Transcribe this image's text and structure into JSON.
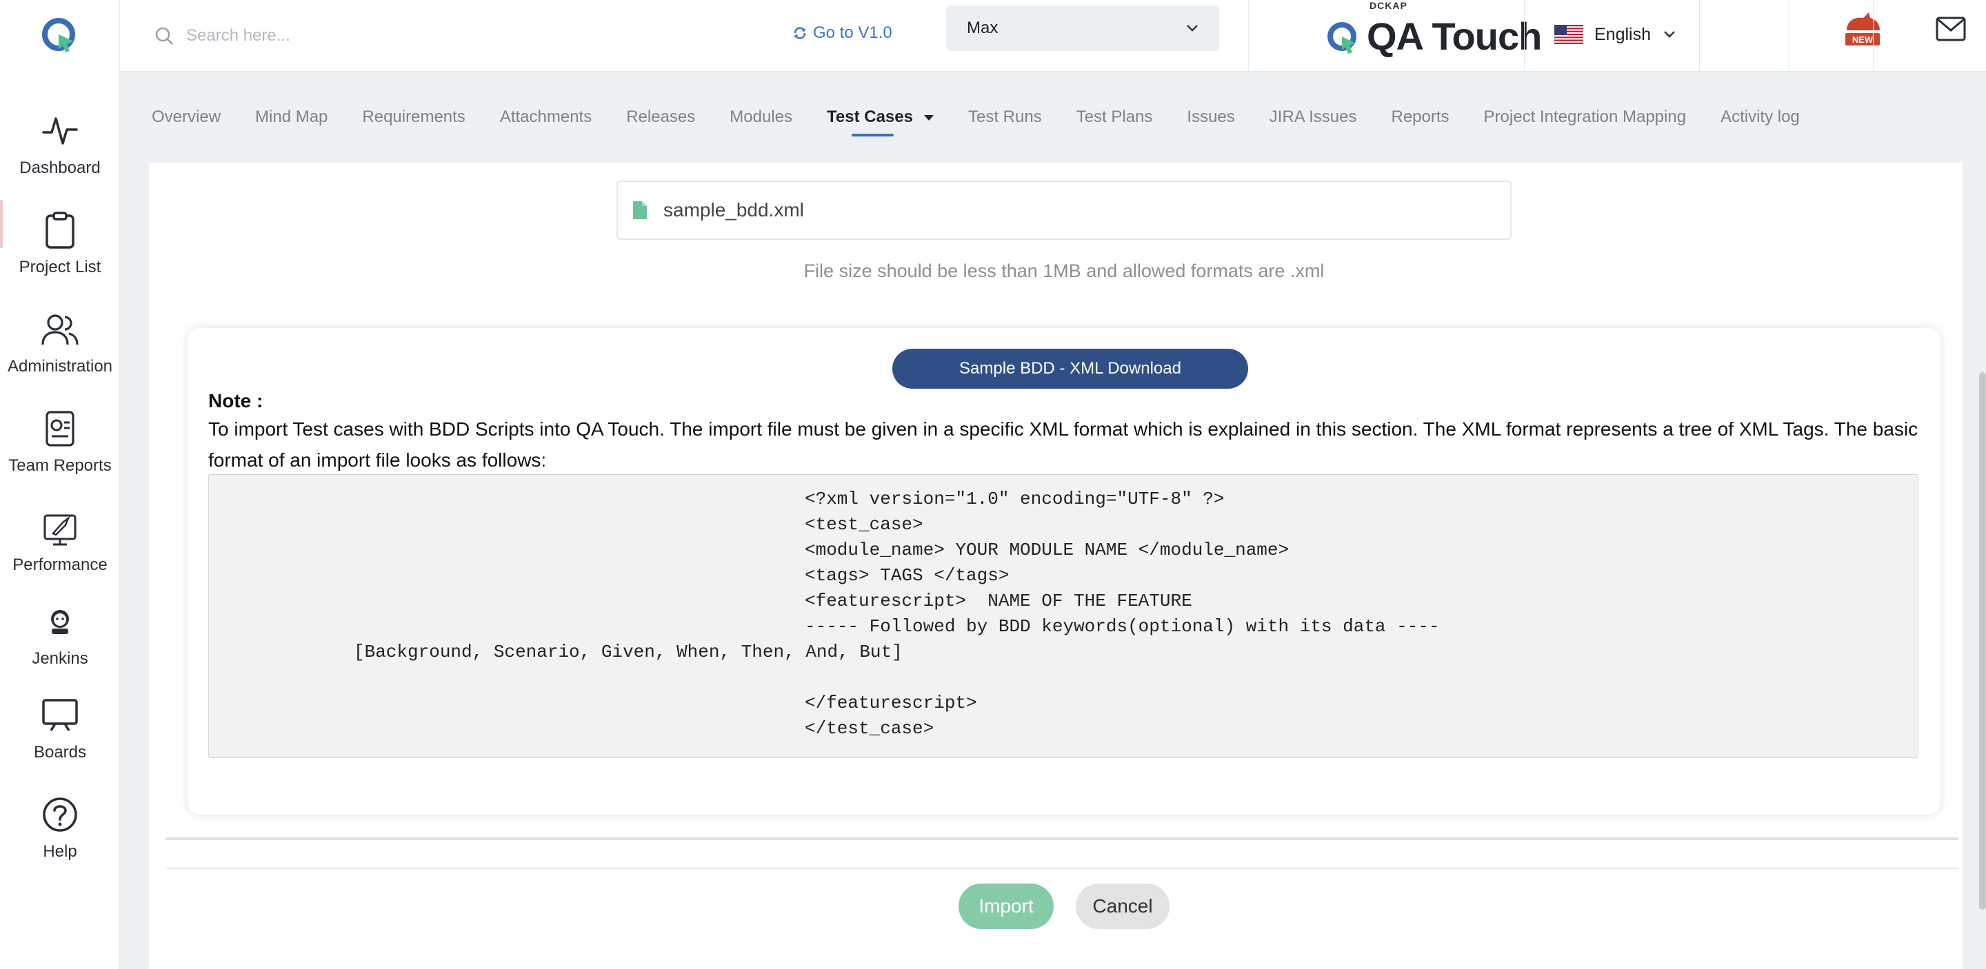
{
  "sidebar": {
    "logo": "qa-touch-logo",
    "items": [
      {
        "label": "Dashboard",
        "icon": "activity-icon"
      },
      {
        "label": "Project List",
        "icon": "clipboard-icon"
      },
      {
        "label": "Administration",
        "icon": "users-icon"
      },
      {
        "label": "Team Reports",
        "icon": "report-icon"
      },
      {
        "label": "Performance",
        "icon": "rocket-icon"
      },
      {
        "label": "Jenkins",
        "icon": "jenkins-icon"
      },
      {
        "label": "Boards",
        "icon": "board-icon"
      },
      {
        "label": "Help",
        "icon": "help-icon"
      }
    ]
  },
  "header": {
    "search_placeholder": "Search here...",
    "goto_label": "Go to V1.0",
    "project_selected": "Max",
    "brand_top": "DCKAP",
    "brand_name": "QA Touch",
    "language": "English",
    "new_badge": "NEW"
  },
  "tabs": [
    {
      "label": "Overview",
      "active": false
    },
    {
      "label": "Mind Map",
      "active": false
    },
    {
      "label": "Requirements",
      "active": false
    },
    {
      "label": "Attachments",
      "active": false
    },
    {
      "label": "Releases",
      "active": false
    },
    {
      "label": "Modules",
      "active": false
    },
    {
      "label": "Test Cases",
      "active": true
    },
    {
      "label": "Test Runs",
      "active": false
    },
    {
      "label": "Test Plans",
      "active": false
    },
    {
      "label": "Issues",
      "active": false
    },
    {
      "label": "JIRA Issues",
      "active": false
    },
    {
      "label": "Reports",
      "active": false
    },
    {
      "label": "Project Integration Mapping",
      "active": false
    },
    {
      "label": "Activity log",
      "active": false
    }
  ],
  "upload": {
    "file_name": "sample_bdd.xml",
    "hint": "File size should be less than 1MB and allowed formats are .xml"
  },
  "note": {
    "download_button": "Sample BDD - XML Download",
    "title": "Note :",
    "text": "To import Test cases with BDD Scripts into QA Touch. The import file must be given in a specific XML format which is explained in this section. The XML format represents a tree of XML Tags. The basic format of an import file looks as follows:",
    "code": [
      "<?xml version=\"1.0\" encoding=\"UTF-8\" ?>",
      "<test_case>",
      "<module_name> YOUR MODULE NAME </module_name>",
      "<tags> TAGS </tags>",
      "<featurescript>  NAME OF THE FEATURE",
      "----- Followed by BDD keywords(optional) with its data ----",
      "[Background, Scenario, Given, When, Then, And, But]",
      "</featurescript>",
      "</test_case>"
    ]
  },
  "actions": {
    "import": "Import",
    "cancel": "Cancel"
  },
  "colors": {
    "primary": "#2f4f86",
    "import_button": "#86cba8",
    "tab_underline": "#3f6fb6",
    "link": "#3a78c4"
  }
}
